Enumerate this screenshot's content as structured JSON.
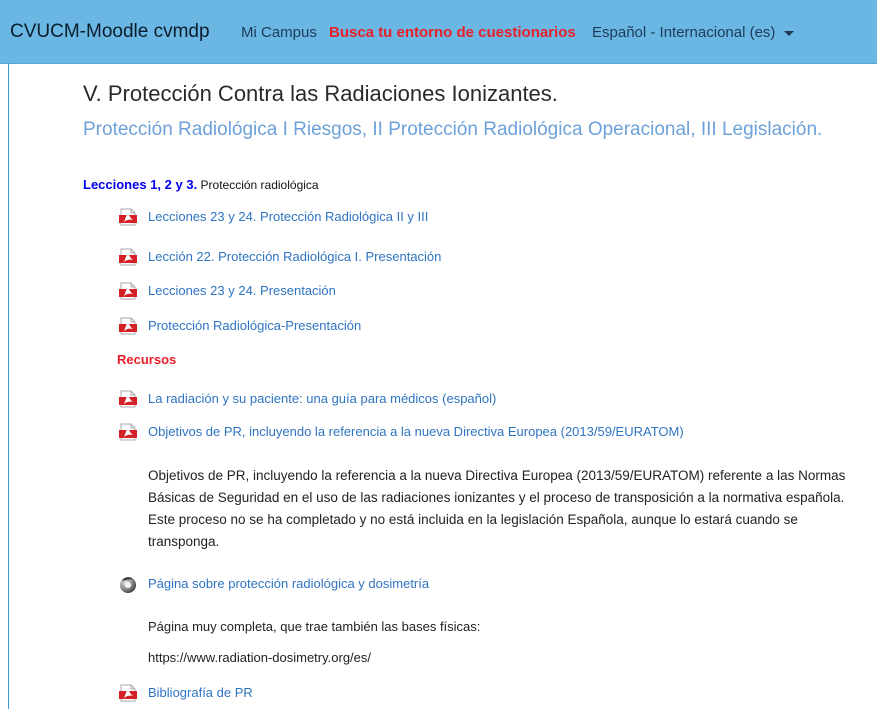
{
  "navbar": {
    "brand": "CVUCM-Moodle cvmdp",
    "mi_campus": "Mi Campus",
    "busca": "Busca tu entorno de cuestionarios",
    "language": "Español - Internacional (es)"
  },
  "section": {
    "title": "V. Protección Contra las Radiaciones Ionizantes.",
    "summary": "Protección Radiológica I Riesgos, II Protección Radiológica Operacional, III Legislación.",
    "lecciones_strong": "Lecciones 1, 2 y 3.",
    "lecciones_rest": " Protección radiológica",
    "recursos_label": "Recursos"
  },
  "activities": [
    {
      "label": "Lecciones 23 y 24. Protección Radiológica II y III",
      "icon": "pdf-icon"
    },
    {
      "label": "Lección 22. Protección Radiológica I. Presentación",
      "icon": "pdf-icon"
    },
    {
      "label": "Lecciones 23 y 24. Presentación",
      "icon": "pdf-icon"
    },
    {
      "label": "Protección Radiológica-Presentación",
      "icon": "pdf-icon"
    },
    {
      "label": "La radiación y su paciente: una guía para médicos (español)",
      "icon": "pdf-icon"
    },
    {
      "label": "Objetivos de PR, incluyendo la referencia a la nueva Directiva Europea (2013/59/EURATOM)",
      "icon": "pdf-icon"
    },
    {
      "label": "Página sobre protección radiológica y dosimetría",
      "icon": "url-icon"
    },
    {
      "label": "Bibliografía de PR",
      "icon": "pdf-icon"
    }
  ],
  "descriptions": {
    "objetivos": "Objetivos de PR, incluyendo la referencia a la nueva Directiva Europea (2013/59/EURATOM) referente a las Normas Básicas de Seguridad en el uso de las radiaciones ionizantes y el proceso de transposición a la normativa española. Este proceso no se ha completado y no está incluida en la legislación Española, aunque lo estará cuando se transponga.",
    "pagina_line1": "Página muy completa, que trae también las bases físicas:",
    "pagina_line2": "https://www.radiation-dosimetry.org/es/"
  },
  "colors": {
    "navbar_bg": "#6bb7e3",
    "link": "#2f74c2",
    "summary": "#6da1d9",
    "accent_red": "#e8202a"
  }
}
